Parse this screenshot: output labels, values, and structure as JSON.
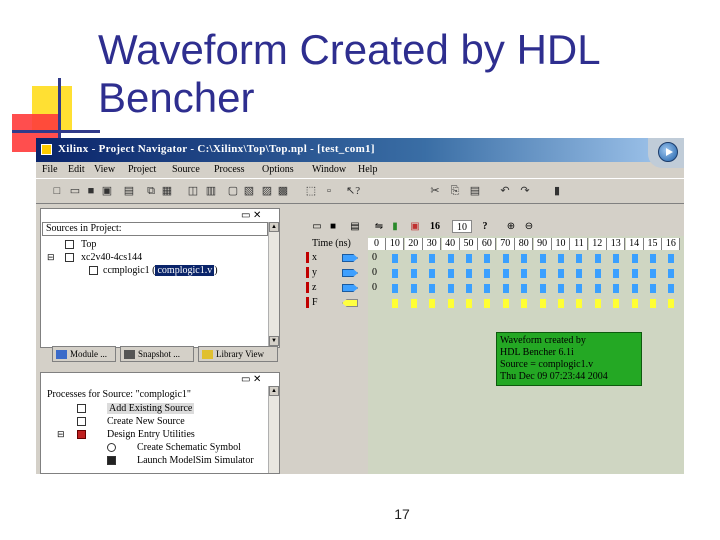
{
  "slide": {
    "title_line1": "Waveform Created by HDL",
    "title_line2": "Bencher",
    "page_number": "17"
  },
  "window": {
    "title": "Xilinx - Project Navigator - C:\\Xilinx\\Top\\Top.npl - [test_com1]"
  },
  "menu": [
    "File",
    "Edit",
    "View",
    "Project",
    "Source",
    "Process",
    "Options",
    "Window",
    "Help"
  ],
  "sources_panel": {
    "title": "Sources in Project:",
    "items": [
      {
        "label": "Top"
      },
      {
        "label": "xc2v40-4cs144"
      },
      {
        "label_prefix": "ccmplogic1 (",
        "label_highlight": "complogic1.v",
        "label_suffix": ")"
      }
    ]
  },
  "tabs": [
    {
      "label": "Module ..."
    },
    {
      "label": "Snapshot ..."
    },
    {
      "label": "Library View"
    }
  ],
  "processes_panel": {
    "title": "Processes for Source: \"complogic1\"",
    "items": [
      {
        "label": "Add Existing Source"
      },
      {
        "label": "Create New Source"
      },
      {
        "label": "Design Entry Utilities"
      },
      {
        "label": "Create Schematic Symbol"
      },
      {
        "label": "Launch ModelSim Simulator"
      }
    ]
  },
  "wave_toolbar": {
    "value_a": "16",
    "value_b": "10",
    "help": "?"
  },
  "waveform": {
    "time_label": "Time (ns)",
    "ticks": [
      "0",
      "10",
      "20",
      "30",
      "40",
      "50",
      "60",
      "70",
      "80",
      "90",
      "10",
      "11",
      "12",
      "13",
      "14",
      "15",
      "16"
    ],
    "signals": [
      {
        "name": "x",
        "value": "0",
        "direction": "input"
      },
      {
        "name": "y",
        "value": "0",
        "direction": "input"
      },
      {
        "name": "z",
        "value": "0",
        "direction": "input"
      },
      {
        "name": "F",
        "value": "",
        "direction": "output"
      }
    ],
    "colors": {
      "input_cell": "#3aa0ff",
      "output_cell": "#ffff33",
      "annotation_bg": "#24a824"
    }
  },
  "annotation": {
    "line1": "Waveform created by",
    "line2": "HDL Bencher 6.1i",
    "line3": "Source = complogic1.v",
    "line4": "Thu Dec 09 07:23:44 2004"
  }
}
